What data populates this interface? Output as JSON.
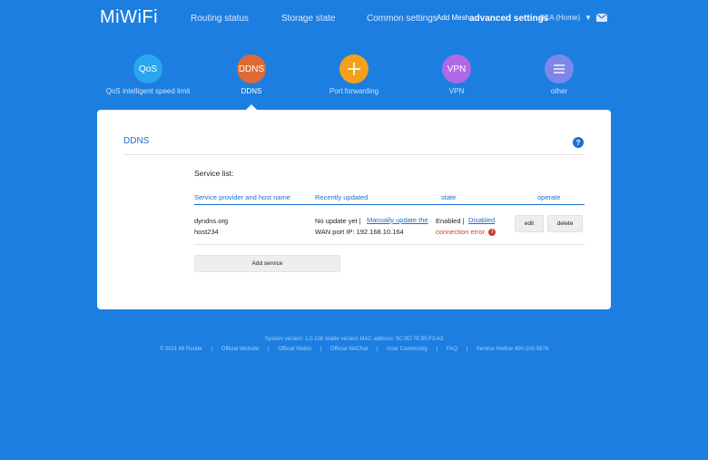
{
  "header": {
    "logo": "MiWiFi",
    "nav": {
      "routing_status": "Routing status",
      "storage_state": "Storage state",
      "common_settings": "Common settings",
      "advanced_settings": "advanced settings"
    },
    "mesh_label": "Add Mesh",
    "router_name": "8CA (Home)",
    "icons": {
      "dropdown": "chevron-down-icon",
      "mail": "mail-icon"
    }
  },
  "tiles": [
    {
      "label": "QoS intelligent speed limit",
      "icon_text": "QoS",
      "color": "#2aa6f0"
    },
    {
      "label": "DDNS",
      "icon_text": "DDNS",
      "color": "#e06a35"
    },
    {
      "label": "Port forwarding",
      "icon": "plus-cross-icon",
      "color": "#f3a11b"
    },
    {
      "label": "VPN",
      "icon_text": "VPN",
      "color": "#b069e6"
    },
    {
      "label": "other",
      "icon": "menu-icon",
      "color": "#7f86ea"
    }
  ],
  "active_tile": "DDNS",
  "card": {
    "title": "DDNS",
    "help_symbol": "?",
    "service_list_label": "Service list:",
    "columns": {
      "provider": "Service provider and host name",
      "updated": "Recently updated",
      "state": "state",
      "operate": "operate"
    },
    "rows": [
      {
        "provider": "dyndns.org",
        "host": "host234",
        "update_status": "No update yet |",
        "manual_update": "Manually update the",
        "wan_ip": "WAN port IP: 192.168.10.164",
        "enabled": "Enabled |",
        "disabled_link": "Disabled",
        "connection": "connection error",
        "error_symbol": "!",
        "edit": "edit",
        "delete": "delete"
      }
    ],
    "add_service": "Add service"
  },
  "footer": {
    "version": "System version: 1.0.108 stable version MAC address: 9C:9D:7E:85:F3:A3",
    "links": [
      "© 2021 Mi Router",
      "Official Website",
      "Official Weibo",
      "Official WeChat",
      "User Community",
      "FAQ",
      "Service Hotline 400-100-5678"
    ],
    "separator": "|"
  },
  "colors": {
    "background": "#1c7ee1",
    "accent": "#1a6fd1",
    "error": "#d23a2e"
  }
}
